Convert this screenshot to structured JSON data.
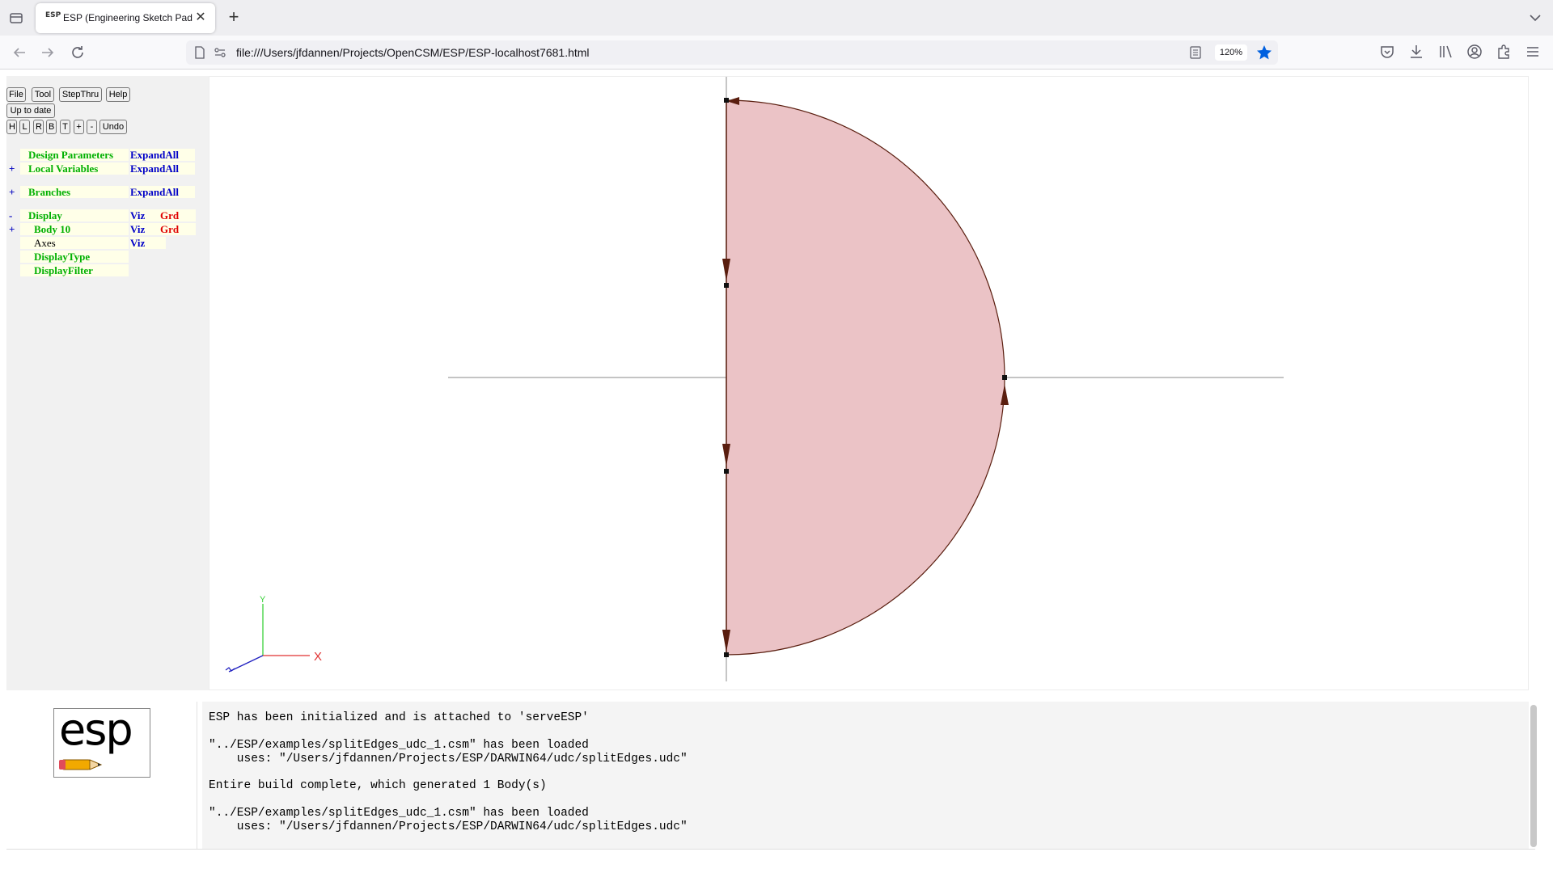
{
  "browser": {
    "tab_title": "ESP (Engineering Sketch Pad, V",
    "tab_favicon": "ESP",
    "new_tab_label": "+",
    "close_tab_label": "✕",
    "url": "file:///Users/jfdannen/Projects/OpenCSM/ESP/ESP-localhost7681.html",
    "zoom": "120%",
    "accent_color": "#0060df",
    "icons": [
      "tab-list-icon",
      "back-icon",
      "forward-icon",
      "reload-icon",
      "page-icon",
      "permissions-icon",
      "reader-view-icon",
      "bookmark-star-icon",
      "pocket-icon",
      "downloads-icon",
      "library-icon",
      "account-icon",
      "extensions-icon",
      "menu-icon",
      "tab-overflow-icon"
    ]
  },
  "toolbar": {
    "file": "File",
    "tool": "Tool",
    "stepthru": "StepThru",
    "help": "Help",
    "status": "Up to date",
    "view_h": "H",
    "view_l": "L",
    "view_r": "R",
    "view_b": "B",
    "view_t": "T",
    "zoom_in": "+",
    "zoom_out": "-",
    "undo": "Undo"
  },
  "tree": {
    "design_parameters": "Design Parameters",
    "local_variables": "Local Variables",
    "branches": "Branches",
    "display": "Display",
    "body10": "Body 10",
    "axes": "Axes",
    "display_type": "DisplayType",
    "display_filter": "DisplayFilter",
    "expand_all": "ExpandAll",
    "viz": "Viz",
    "grd": "Grd",
    "plus": "+",
    "minus": "-"
  },
  "graphics": {
    "face_color": "#ebc3c6",
    "edge_color": "#5a1e0f",
    "axis_labels": {
      "x": "X",
      "y": "Y"
    }
  },
  "messages": [
    "ESP has been initialized and is attached to 'serveESP'",
    "\"../ESP/examples/splitEdges_udc_1.csm\" has been loaded",
    "    uses: \"/Users/jfdannen/Projects/ESP/DARWIN64/udc/splitEdges.udc\"",
    "Entire build complete, which generated 1 Body(s)",
    "\"../ESP/examples/splitEdges_udc_1.csm\" has been loaded",
    "    uses: \"/Users/jfdannen/Projects/ESP/DARWIN64/udc/splitEdges.udc\""
  ],
  "logo_text": "esp"
}
